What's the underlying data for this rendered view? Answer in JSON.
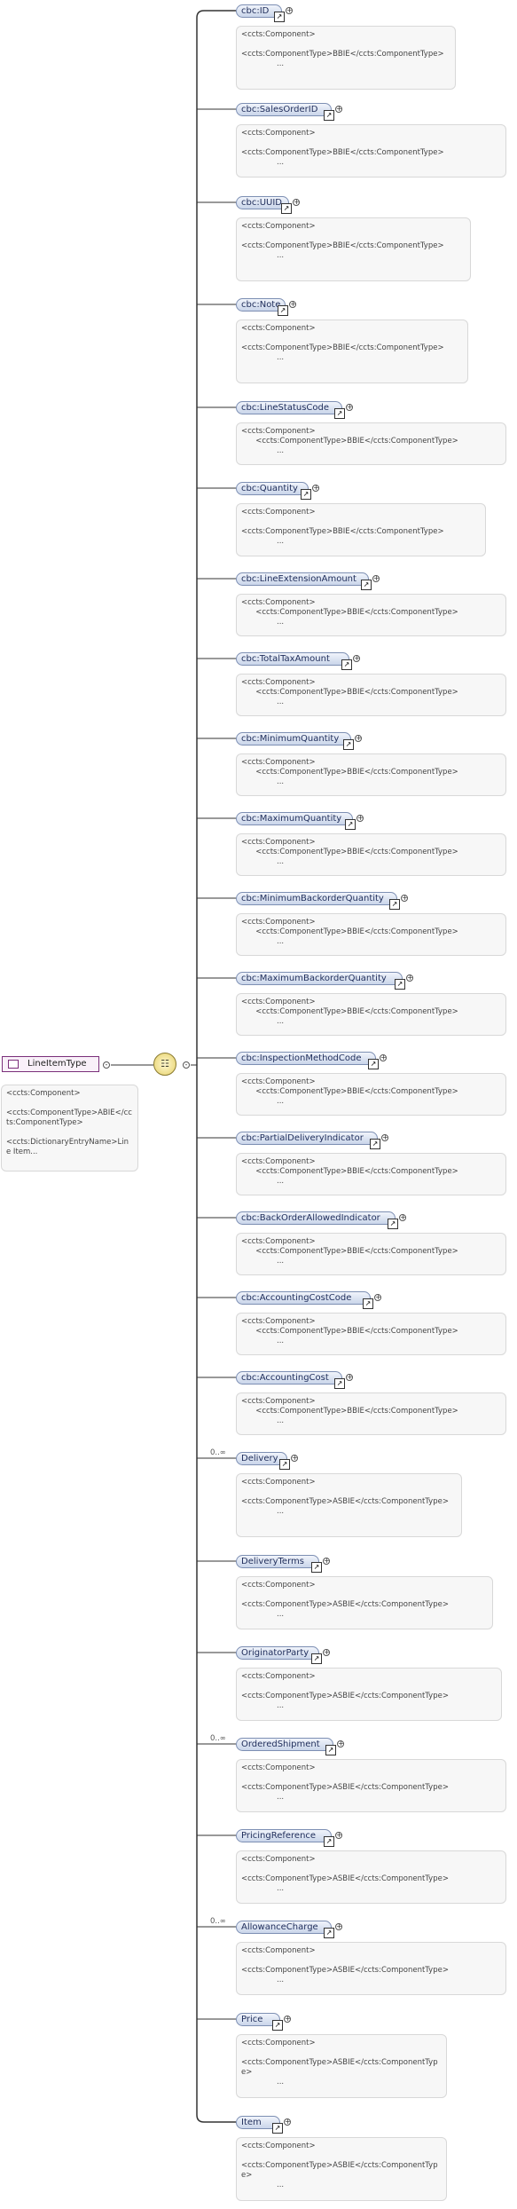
{
  "root": {
    "name": "LineItemType",
    "doc": [
      "<ccts:Component>",
      "",
      "<ccts:ComponentType>ABIE</ccts:ComponentType>",
      "",
      "<ccts:DictionaryEntryName>Line Item..."
    ]
  },
  "sequence_icon": "sequence-compositor-icon",
  "elements": [
    {
      "name": "cbc:ID",
      "card": "",
      "doc": [
        "<ccts:Component>",
        "",
        "<ccts:ComponentType>BBIE</ccts:ComponentType>"
      ]
    },
    {
      "name": "cbc:SalesOrderID",
      "card": "",
      "doc": [
        "<ccts:Component>",
        "",
        "<ccts:ComponentType>BBIE</ccts:ComponentType>"
      ]
    },
    {
      "name": "cbc:UUID",
      "card": "",
      "doc": [
        "<ccts:Component>",
        "",
        "<ccts:ComponentType>BBIE</ccts:ComponentType>"
      ]
    },
    {
      "name": "cbc:Note",
      "card": "",
      "doc": [
        "<ccts:Component>",
        "",
        "<ccts:ComponentType>BBIE</ccts:ComponentType>"
      ]
    },
    {
      "name": "cbc:LineStatusCode",
      "card": "",
      "doc": [
        "<ccts:Component>",
        "      <ccts:ComponentType>BBIE</ccts:ComponentType>"
      ]
    },
    {
      "name": "cbc:Quantity",
      "card": "",
      "doc": [
        "<ccts:Component>",
        "",
        "<ccts:ComponentType>BBIE</ccts:ComponentType>"
      ]
    },
    {
      "name": "cbc:LineExtensionAmount",
      "card": "",
      "doc": [
        "<ccts:Component>",
        "      <ccts:ComponentType>BBIE</ccts:ComponentType>"
      ]
    },
    {
      "name": "cbc:TotalTaxAmount",
      "card": "",
      "doc": [
        "<ccts:Component>",
        "      <ccts:ComponentType>BBIE</ccts:ComponentType>"
      ]
    },
    {
      "name": "cbc:MinimumQuantity",
      "card": "",
      "doc": [
        "<ccts:Component>",
        "      <ccts:ComponentType>BBIE</ccts:ComponentType>"
      ]
    },
    {
      "name": "cbc:MaximumQuantity",
      "card": "",
      "doc": [
        "<ccts:Component>",
        "      <ccts:ComponentType>BBIE</ccts:ComponentType>"
      ]
    },
    {
      "name": "cbc:MinimumBackorderQuantity",
      "card": "",
      "doc": [
        "<ccts:Component>",
        "      <ccts:ComponentType>BBIE</ccts:ComponentType>"
      ]
    },
    {
      "name": "cbc:MaximumBackorderQuantity",
      "card": "",
      "doc": [
        "<ccts:Component>",
        "      <ccts:ComponentType>BBIE</ccts:ComponentType>"
      ]
    },
    {
      "name": "cbc:InspectionMethodCode",
      "card": "",
      "doc": [
        "<ccts:Component>",
        "      <ccts:ComponentType>BBIE</ccts:ComponentType>"
      ]
    },
    {
      "name": "cbc:PartialDeliveryIndicator",
      "card": "",
      "doc": [
        "<ccts:Component>",
        "      <ccts:ComponentType>BBIE</ccts:ComponentType>"
      ]
    },
    {
      "name": "cbc:BackOrderAllowedIndicator",
      "card": "",
      "doc": [
        "<ccts:Component>",
        "      <ccts:ComponentType>BBIE</ccts:ComponentType>"
      ]
    },
    {
      "name": "cbc:AccountingCostCode",
      "card": "",
      "doc": [
        "<ccts:Component>",
        "      <ccts:ComponentType>BBIE</ccts:ComponentType>"
      ]
    },
    {
      "name": "cbc:AccountingCost",
      "card": "",
      "doc": [
        "<ccts:Component>",
        "      <ccts:ComponentType>BBIE</ccts:ComponentType>"
      ]
    },
    {
      "name": "Delivery",
      "card": "0..∞",
      "doc": [
        "<ccts:Component>",
        "",
        "<ccts:ComponentType>ASBIE</ccts:ComponentType>"
      ]
    },
    {
      "name": "DeliveryTerms",
      "card": "",
      "doc": [
        "<ccts:Component>",
        "",
        "<ccts:ComponentType>ASBIE</ccts:ComponentType>"
      ]
    },
    {
      "name": "OriginatorParty",
      "card": "",
      "doc": [
        "<ccts:Component>",
        "",
        "<ccts:ComponentType>ASBIE</ccts:ComponentType>"
      ]
    },
    {
      "name": "OrderedShipment",
      "card": "0..∞",
      "doc": [
        "<ccts:Component>",
        "",
        "<ccts:ComponentType>ASBIE</ccts:ComponentType>"
      ]
    },
    {
      "name": "PricingReference",
      "card": "",
      "doc": [
        "<ccts:Component>",
        "",
        "<ccts:ComponentType>ASBIE</ccts:ComponentType>"
      ]
    },
    {
      "name": "AllowanceCharge",
      "card": "0..∞",
      "doc": [
        "<ccts:Component>",
        "",
        "<ccts:ComponentType>ASBIE</ccts:ComponentType>"
      ]
    },
    {
      "name": "Price",
      "card": "",
      "doc": [
        "<ccts:Component>",
        "",
        "<ccts:ComponentType>ASBIE</ccts:ComponentType>"
      ]
    },
    {
      "name": "Item",
      "card": "",
      "doc": [
        "<ccts:Component>",
        "",
        "<ccts:ComponentType>ASBIE</ccts:ComponentType>"
      ]
    }
  ],
  "ellipsis": "..."
}
